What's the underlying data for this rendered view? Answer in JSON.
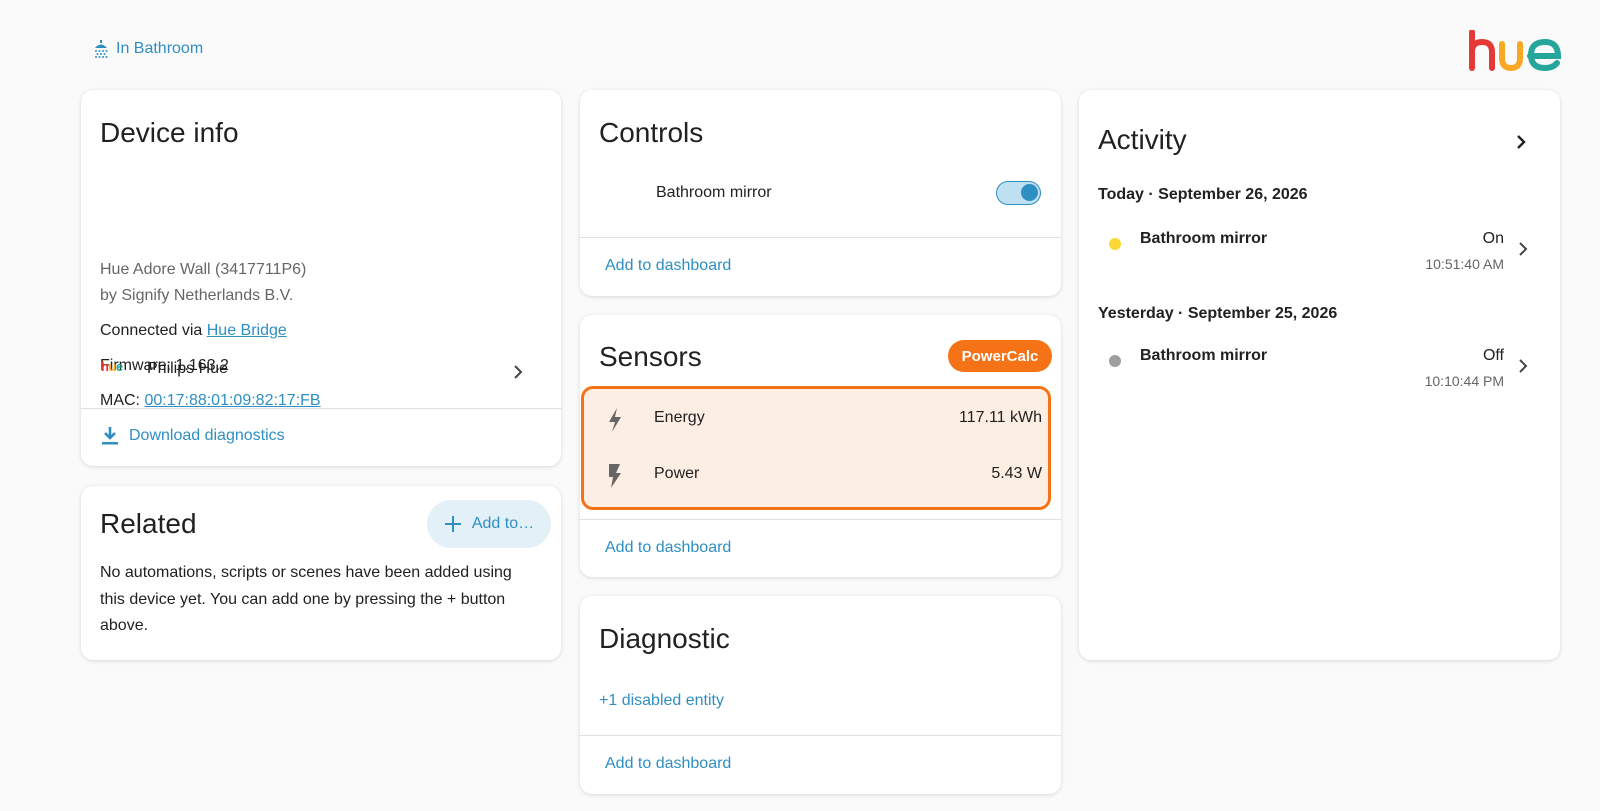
{
  "breadcrumb": {
    "area_label": "In Bathroom"
  },
  "brand": {
    "logo_text": "hue"
  },
  "device_info": {
    "title": "Device info",
    "model": "Hue Adore Wall (3417711P6)",
    "manufacturer": "by Signify Netherlands B.V.",
    "connected_prefix": "Connected via",
    "connected_link": "Hue Bridge",
    "firmware": "Firmware: 1.163.2",
    "mac_prefix": "MAC:",
    "mac_link": "00:17:88:01:09:82:17:FB",
    "integration_logo": "hue",
    "integration_name": "Philips Hue",
    "download_label": "Download diagnostics"
  },
  "related": {
    "title": "Related",
    "add_button": "Add to…",
    "message": "No automations, scripts or scenes have been added using this device yet. You can add one by pressing the + button above."
  },
  "controls": {
    "title": "Controls",
    "entity": "Bathroom mirror",
    "toggle_state": "on",
    "action": "Add to dashboard"
  },
  "sensors": {
    "title": "Sensors",
    "badge": "PowerCalc",
    "rows": [
      {
        "name": "Energy",
        "value": "117.11 kWh",
        "icon": "lightning-bolt-icon"
      },
      {
        "name": "Power",
        "value": "5.43 W",
        "icon": "flash-icon"
      }
    ],
    "action": "Add to dashboard"
  },
  "diagnostic": {
    "title": "Diagnostic",
    "disabled_link": "+1 disabled entity",
    "action": "Add to dashboard"
  },
  "activity": {
    "title": "Activity",
    "groups": [
      {
        "date": "Today · September 26, 2026",
        "entries": [
          {
            "name": "Bathroom mirror",
            "state": "On",
            "time": "10:51:40 AM",
            "dot_color": "#fdd835"
          }
        ]
      },
      {
        "date": "Yesterday · September 25, 2026",
        "entries": [
          {
            "name": "Bathroom mirror",
            "state": "Off",
            "time": "10:10:44 PM",
            "dot_color": "#9e9e9e"
          }
        ]
      }
    ]
  },
  "colors": {
    "accent": "#2f8fc2",
    "powercalc": "#f57316",
    "highlight_bg": "#fdeee4"
  }
}
